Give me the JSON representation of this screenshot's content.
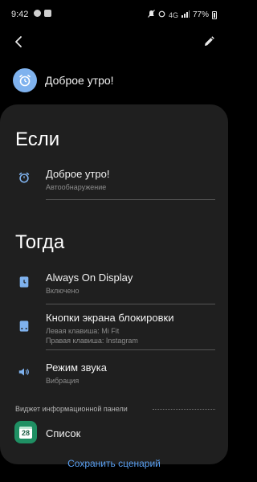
{
  "status_bar": {
    "time": "9:42",
    "network": "4G",
    "battery": "77%"
  },
  "toolbar": {
    "back_icon": "back-arrow-icon",
    "edit_icon": "pencil-icon"
  },
  "routine": {
    "title": "Доброе утро!",
    "icon": "alarm-clock-icon",
    "icon_color": "#7fb2ee"
  },
  "if_section": {
    "heading": "Если",
    "items": [
      {
        "title": "Доброе утро!",
        "subtitle": "Автообнаружение",
        "icon": "alarm-clock-icon"
      }
    ]
  },
  "then_section": {
    "heading": "Тогда",
    "items": [
      {
        "title": "Always On Display",
        "subtitle": "Включено",
        "icon": "clock-screen-icon"
      },
      {
        "title": "Кнопки экрана блокировки",
        "subtitle": "Левая клавиша: Mi Fit",
        "subtitle2": "Правая клавиша: Instagram",
        "icon": "phone-lock-icon"
      },
      {
        "title": "Режим звука",
        "subtitle": "Вибрация",
        "icon": "speaker-icon"
      }
    ]
  },
  "widget_section": {
    "label": "Виджет информационной панели",
    "item_title": "Список",
    "item_icon": "calendar-icon",
    "calendar_day": "28"
  },
  "footer": {
    "save_label": "Сохранить сценарий"
  },
  "colors": {
    "accent": "#5aa0f2",
    "panel": "#1f1f1f",
    "icon_blue": "#7fb2ee",
    "widget_green": "#1f8f63"
  }
}
